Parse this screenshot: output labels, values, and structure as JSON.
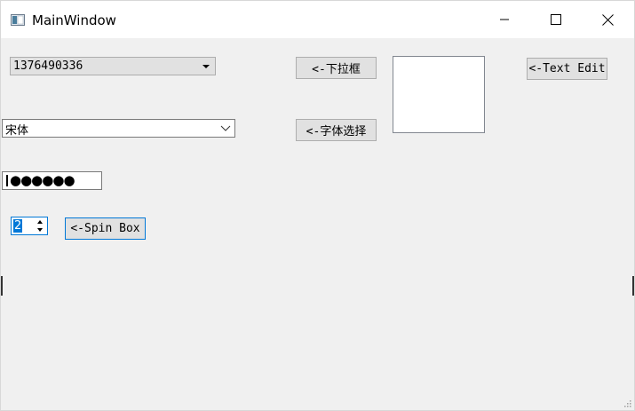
{
  "window": {
    "title": "MainWindow"
  },
  "combo_number": {
    "value": "1376490336"
  },
  "combo_font": {
    "value": "宋体"
  },
  "buttons": {
    "dropdown_label": "<-下拉框",
    "font_select_label": "<-字体选择",
    "text_edit_label": "<-Text Edit",
    "spin_box_label": "<-Spin Box"
  },
  "password": {
    "masked": "●●●●●●"
  },
  "spinbox": {
    "value": "2"
  },
  "colors": {
    "accent": "#0078d7",
    "button_bg": "#e1e1e1",
    "window_bg": "#f0f0f0"
  },
  "icons": {
    "app": "app-window-icon",
    "minimize": "minimize-icon",
    "maximize": "maximize-icon",
    "close": "close-icon",
    "dropdown": "triangle-down-icon",
    "font_dropdown": "chevron-down-icon",
    "resize": "resize-grip-icon"
  }
}
